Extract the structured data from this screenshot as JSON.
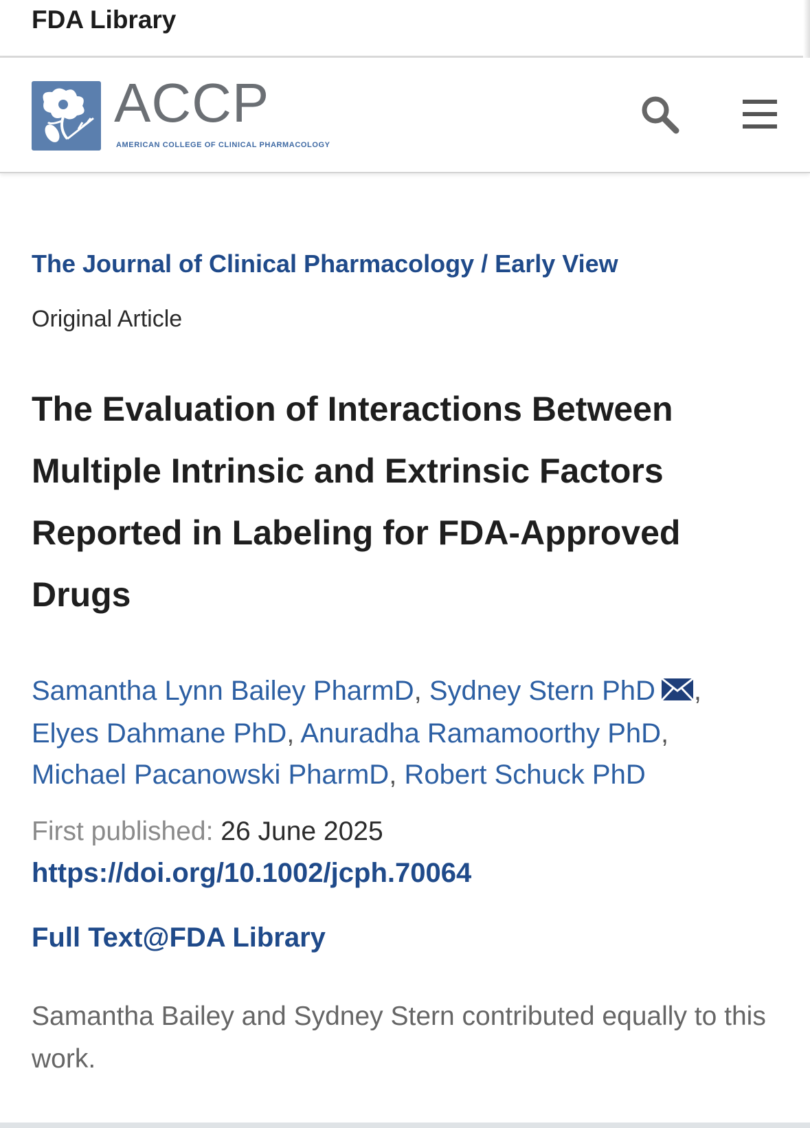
{
  "institution_bar": {
    "label": "FDA Library"
  },
  "logo": {
    "name": "ACCP",
    "subtitle": "AMERICAN COLLEGE OF CLINICAL PHARMACOLOGY",
    "icon": "flower-logo-icon",
    "color": "#5b7fae"
  },
  "header_icons": {
    "search": "search-icon",
    "menu": "hamburger-menu-icon"
  },
  "breadcrumb": {
    "journal": "The Journal of Clinical Pharmacology",
    "separator": " / ",
    "section": "Early View"
  },
  "article": {
    "type": "Original Article",
    "title": "The Evaluation of Interactions Between Multiple Intrinsic and Extrinsic Factors Reported in Labeling for FDA-Approved Drugs",
    "authors": [
      "Samantha Lynn Bailey PharmD",
      "Sydney Stern PhD",
      "Elyes Dahmane PhD",
      "Anuradha Ramamoorthy PhD",
      "Michael Pacanowski PharmD",
      "Robert Schuck PhD"
    ],
    "author_separator": ", ",
    "first_published_label": "First published:",
    "first_published_date": "26 June 2025",
    "doi": "https://doi.org/10.1002/jcph.70064",
    "full_text_link": "Full Text@FDA Library",
    "note": "Samantha Bailey and Sydney Stern contributed equally to this work."
  },
  "colors": {
    "link": "#2c5fa3",
    "link_bold": "#1f4a8a",
    "muted": "#8a8a8a"
  }
}
